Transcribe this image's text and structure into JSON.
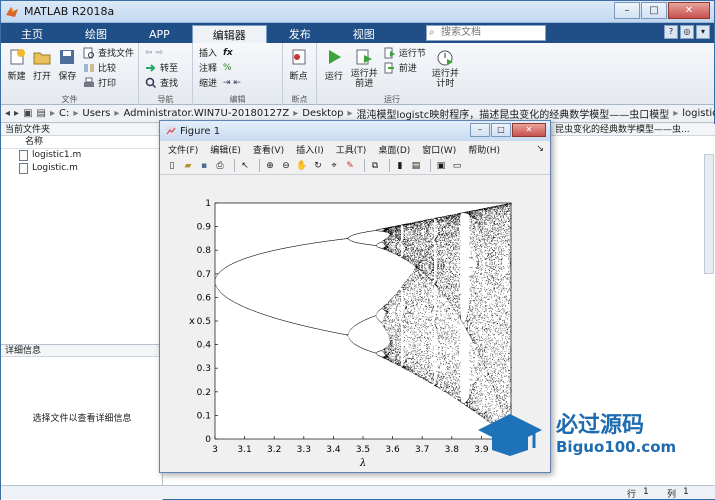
{
  "window": {
    "title": "MATLAB R2018a"
  },
  "tabs": [
    "主页",
    "绘图",
    "APP",
    "编辑器",
    "发布",
    "视图"
  ],
  "search": {
    "placeholder": "搜索文档"
  },
  "ribbon": {
    "groups": [
      {
        "label": "文件",
        "big": [
          "新建",
          "打开",
          "保存"
        ],
        "small": [
          "查找文件",
          "比较",
          "打印"
        ]
      },
      {
        "label": "导航",
        "small": [
          "转至",
          "查找"
        ]
      },
      {
        "label": "编辑",
        "small": [
          "插入",
          "注释",
          "缩进"
        ],
        "symbols": [
          "fx",
          "%",
          "%"
        ]
      },
      {
        "label": "断点",
        "big": [
          "断点"
        ]
      },
      {
        "label": "运行",
        "big": [
          "运行",
          "运行并\n前进",
          "运行并\n计时"
        ],
        "small": [
          "运行节",
          "前进"
        ]
      }
    ]
  },
  "address": {
    "crumbs": [
      "C:",
      "Users",
      "Administrator.WIN7U-20180127Z",
      "Desktop",
      "混沌模型logistc映射程序，描述昆虫变化的经典数学模型——虫口模型",
      "logistic"
    ]
  },
  "left_panel": {
    "title": "当前文件夹",
    "column": "名称",
    "files": [
      "logistic1.m",
      "Logistic.m"
    ],
    "details_title": "详细信息",
    "details_hint": "选择文件以查看详细信息"
  },
  "cmd_area": {
    "header": "昆虫变化的经典数学模型——虫..."
  },
  "statusbar": {
    "row_label": "行",
    "row": "1",
    "col_label": "列",
    "col": "1"
  },
  "figure": {
    "title": "Figure 1",
    "menu": [
      "文件(F)",
      "编辑(E)",
      "查看(V)",
      "插入(I)",
      "工具(T)",
      "桌面(D)",
      "窗口(W)",
      "帮助(H)"
    ]
  },
  "chart_data": {
    "type": "scatter",
    "description_kind": "bifurcation",
    "xlabel": "λ",
    "ylabel": "x",
    "xlim": [
      3,
      4
    ],
    "ylim": [
      0,
      1
    ],
    "xticks": [
      "3",
      "3.1",
      "3.2",
      "3.3",
      "3.4",
      "3.5",
      "3.6",
      "3.7",
      "3.8",
      "3.9",
      "4"
    ],
    "yticks": [
      "0",
      "0.1",
      "0.2",
      "0.3",
      "0.4",
      "0.5",
      "0.6",
      "0.7",
      "0.8",
      "0.9",
      "1"
    ],
    "map": "x_{n+1} = λ x_n (1 - x_n)",
    "lambda_step": 0.002,
    "points_per_lambda": 60,
    "marker_color": "#000000"
  },
  "watermark": {
    "text": "必过源码",
    "url_text": "Biguo100.com"
  },
  "colors": {
    "tab_bar": "#1f4f86",
    "accent": "#3a6ea5"
  }
}
